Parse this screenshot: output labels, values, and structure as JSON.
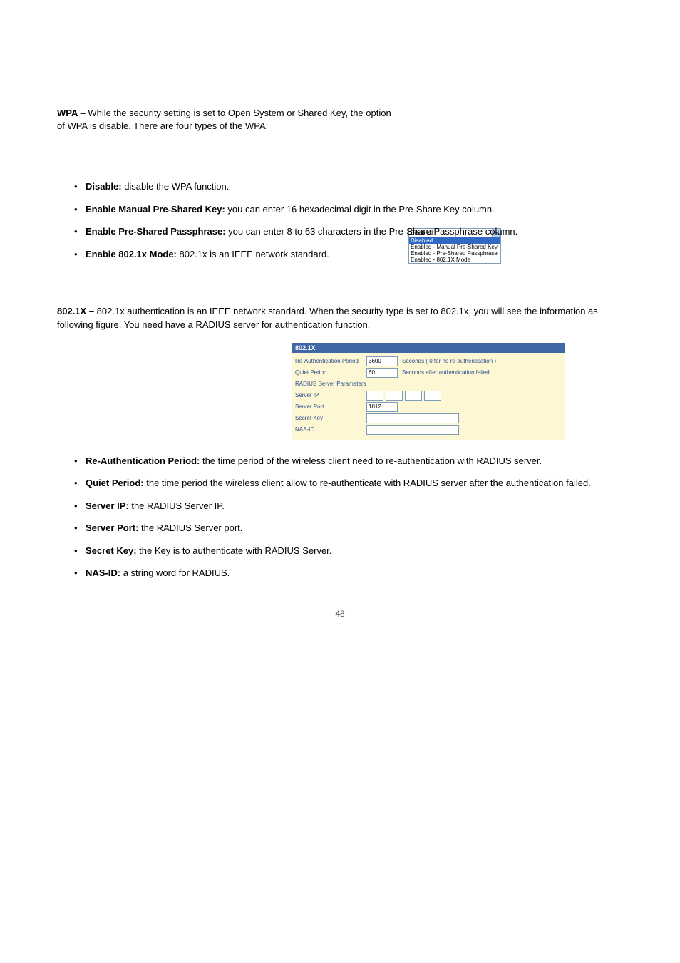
{
  "wpa_intro": {
    "heading_prefix": "WPA ",
    "heading_rest": "– While the security setting is set to Open System or Shared Key, the option of WPA is disable. There are four types of the WPA:"
  },
  "dropdown": {
    "selected": "Disabled",
    "options": [
      "Disabled",
      "Enabled - Manual Pre-Shared Key",
      "Enabled - Pre-Shared Passphrase",
      "Enabled - 802.1X Mode"
    ]
  },
  "wpa_bullets": [
    {
      "bold": "Disable: ",
      "text": "disable the WPA function."
    },
    {
      "bold": "Enable Manual Pre-Shared Key: ",
      "text": "you can enter 16 hexadecimal digit in the Pre-Share Key column."
    },
    {
      "bold": "Enable Pre-Shared Passphrase: ",
      "text": "you can enter 8 to 63 characters in the Pre-Share Passphrase column."
    },
    {
      "bold": "Enable 802.1x Mode: ",
      "text": "802.1x is an IEEE network standard."
    }
  ],
  "sec_802": {
    "heading_prefix": "802.1X – ",
    "heading_rest": "802.1x authentication is an IEEE network standard. When the security type is set to 802.1x, you will see the information as following figure. You need have a RADIUS server for authentication function.",
    "panel_title": "802.1X",
    "rows": {
      "reauth_label": "Re-Authentication Period",
      "reauth_value": "3600",
      "reauth_hint": "Seconds ( 0 for no re-authentication )",
      "quiet_label": "Quiet Period",
      "quiet_value": "60",
      "quiet_hint": "Seconds after authentication failed",
      "radius_label": "RADIUS Server Parameters",
      "serverip_label": "Server IP",
      "serverport_label": "Server Port",
      "serverport_value": "1812",
      "secretkey_label": "Secret Key",
      "nasid_label": "NAS-ID"
    }
  },
  "bullets_802": [
    {
      "bold": "Re-Authentication Period: ",
      "text": "the time period of the wireless client need to re-authentication with RADIUS server."
    },
    {
      "bold": "Quiet Period: ",
      "text": "the time period the wireless client allow to re-authenticate with RADIUS server after the authentication failed."
    },
    {
      "bold": "Server IP: ",
      "text": "the RADIUS Server IP."
    },
    {
      "bold": "Server Port: ",
      "text": "the RADIUS Server port."
    },
    {
      "bold": "Secret Key: ",
      "text": "the Key is to authenticate with RADIUS Server."
    },
    {
      "bold": "NAS-ID: ",
      "text": "a string word for RADIUS."
    }
  ],
  "footer": "48"
}
